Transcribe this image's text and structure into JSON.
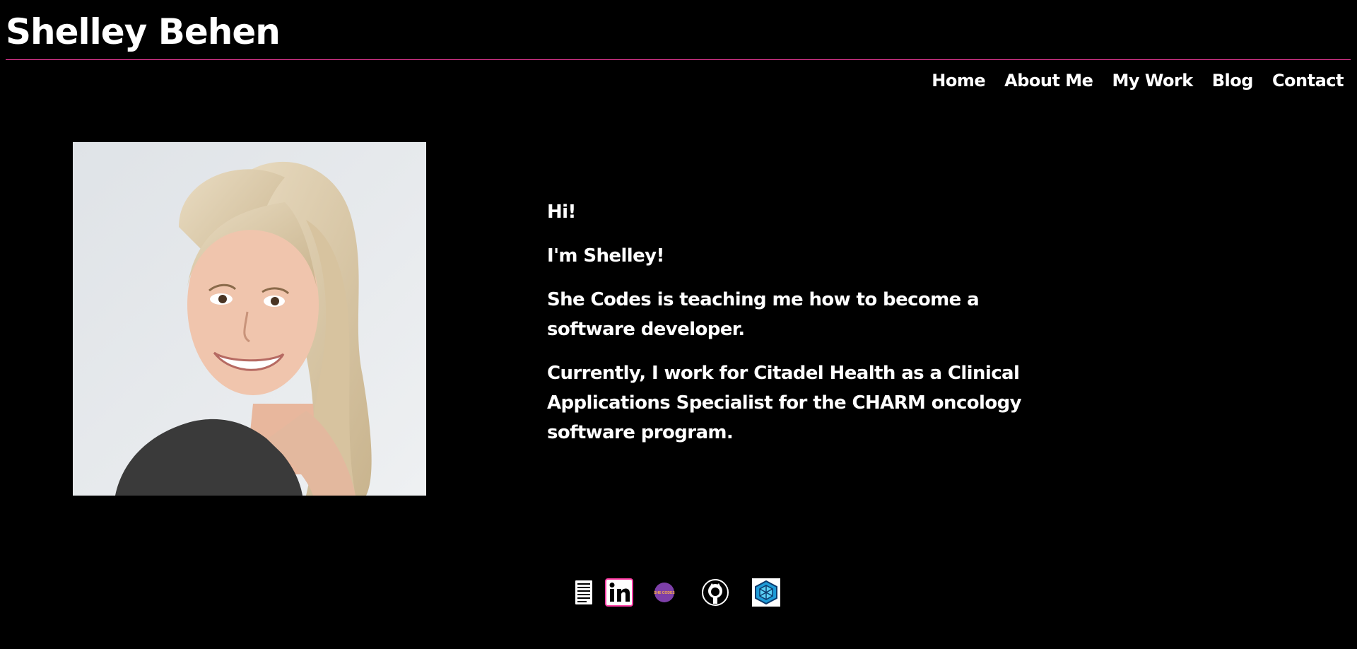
{
  "header": {
    "title": "Shelley Behen",
    "accent_color": "#ff3ea5"
  },
  "nav": {
    "items": [
      {
        "label": "Home"
      },
      {
        "label": "About Me"
      },
      {
        "label": "My Work"
      },
      {
        "label": "Blog"
      },
      {
        "label": "Contact"
      }
    ]
  },
  "profile": {
    "photo_alt": "Shelley Behen"
  },
  "intro": {
    "greeting": "Hi!",
    "name_line": "I'm Shelley!",
    "line_she_codes": "She Codes is teaching me how to become a software developer.",
    "line_work": "Currently, I work for Citadel Health as a Clinical Applications Specialist for the CHARM oncology software program."
  },
  "social_links": [
    {
      "icon": "resume-icon"
    },
    {
      "icon": "linkedin-icon"
    },
    {
      "icon": "she-codes-icon",
      "logo_text": "SHE CODES"
    },
    {
      "icon": "github-icon"
    },
    {
      "icon": "codepen-icon"
    }
  ]
}
